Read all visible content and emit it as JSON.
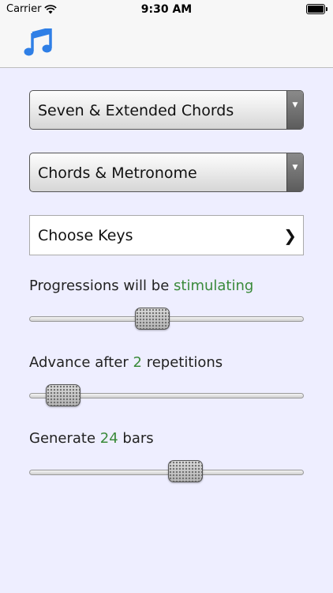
{
  "status_bar": {
    "carrier": "Carrier",
    "time": "9:30 AM"
  },
  "nav": {
    "icon": "music-notes-icon",
    "icon_color": "#2f7fe6"
  },
  "selects": {
    "chord_type": "Seven & Extended Chords",
    "accompaniment": "Chords & Metronome"
  },
  "keys": {
    "label": "Choose Keys",
    "chevron": "❯"
  },
  "sliders": {
    "progressions": {
      "prefix": "Progressions will be ",
      "value": "stimulating",
      "suffix": "",
      "level": 0.44
    },
    "advance": {
      "prefix": "Advance after ",
      "value": "2",
      "suffix": " repetitions",
      "level": 0.07
    },
    "bars": {
      "prefix": "Generate ",
      "value": "24",
      "suffix": " bars",
      "level": 0.58
    }
  },
  "colors": {
    "highlight": "#3a8a3a",
    "background": "#eeeeff"
  }
}
